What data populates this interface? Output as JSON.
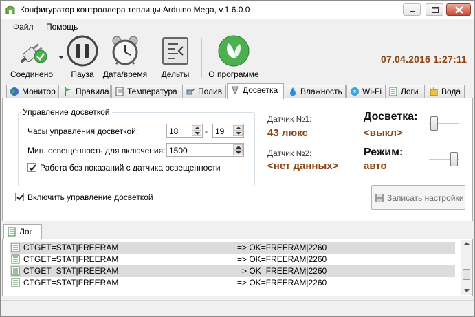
{
  "window": {
    "title": "Конфигуратор контроллера теплицы Arduino Mega, v.1.6.0.0"
  },
  "menu": {
    "items": [
      "Файл",
      "Помощь"
    ]
  },
  "toolbar": {
    "connect_label": "Соединено",
    "pause_label": "Пауза",
    "datetime_label": "Дата/время",
    "deltas_label": "Дельты",
    "about_label": "О программе",
    "clock": "07.04.2016 1:27:11"
  },
  "tabs": [
    {
      "label": "Монитор",
      "icon": "globe-icon"
    },
    {
      "label": "Правила",
      "icon": "flag-icon"
    },
    {
      "label": "Температура",
      "icon": "document-icon"
    },
    {
      "label": "Полив",
      "icon": "watering-can-icon"
    },
    {
      "label": "Досветка",
      "icon": "lamp-icon",
      "active": true
    },
    {
      "label": "Влажность",
      "icon": "water-drop-icon"
    },
    {
      "label": "Wi-Fi",
      "icon": "wifi-icon"
    },
    {
      "label": "Логи",
      "icon": "log-icon"
    },
    {
      "label": "Вода",
      "icon": "water-icon"
    }
  ],
  "lighting": {
    "group_title": "Управление досветкой",
    "hours_label": "Часы управления досветкой:",
    "hour_from": "18",
    "hour_to": "19",
    "dash": "-",
    "min_lux_label": "Мин. освещенность для включения:",
    "min_lux": "1500",
    "work_without_sensor_label": "Работа без показаний с датчика освещенности",
    "work_without_sensor_checked": true,
    "enable_label": "Включить управление досветкой",
    "enable_checked": true,
    "sensor1_label": "Датчик №1:",
    "sensor1_value": "43 люкс",
    "sensor2_label": "Датчик №2:",
    "sensor2_value": "<нет данных>",
    "light_title": "Досветка:",
    "light_state": "<выкл>",
    "light_slider_value": 0,
    "mode_title": "Режим:",
    "mode_state": "авто",
    "mode_slider_value": 1,
    "save_button": "Записать настройки"
  },
  "log": {
    "tab_label": "Лог",
    "rows": [
      {
        "cmd": "CTGET=STAT|FREERAM",
        "resp": "=> OK=FREERAM|2260"
      },
      {
        "cmd": "CTGET=STAT|FREERAM",
        "resp": "=> OK=FREERAM|2260"
      },
      {
        "cmd": "CTGET=STAT|FREERAM",
        "resp": "=> OK=FREERAM|2260"
      },
      {
        "cmd": "CTGET=STAT|FREERAM",
        "resp": "=> OK=FREERAM|2260"
      }
    ]
  },
  "colors": {
    "accent_brown": "#8b4513",
    "active_green": "#4caf50"
  }
}
